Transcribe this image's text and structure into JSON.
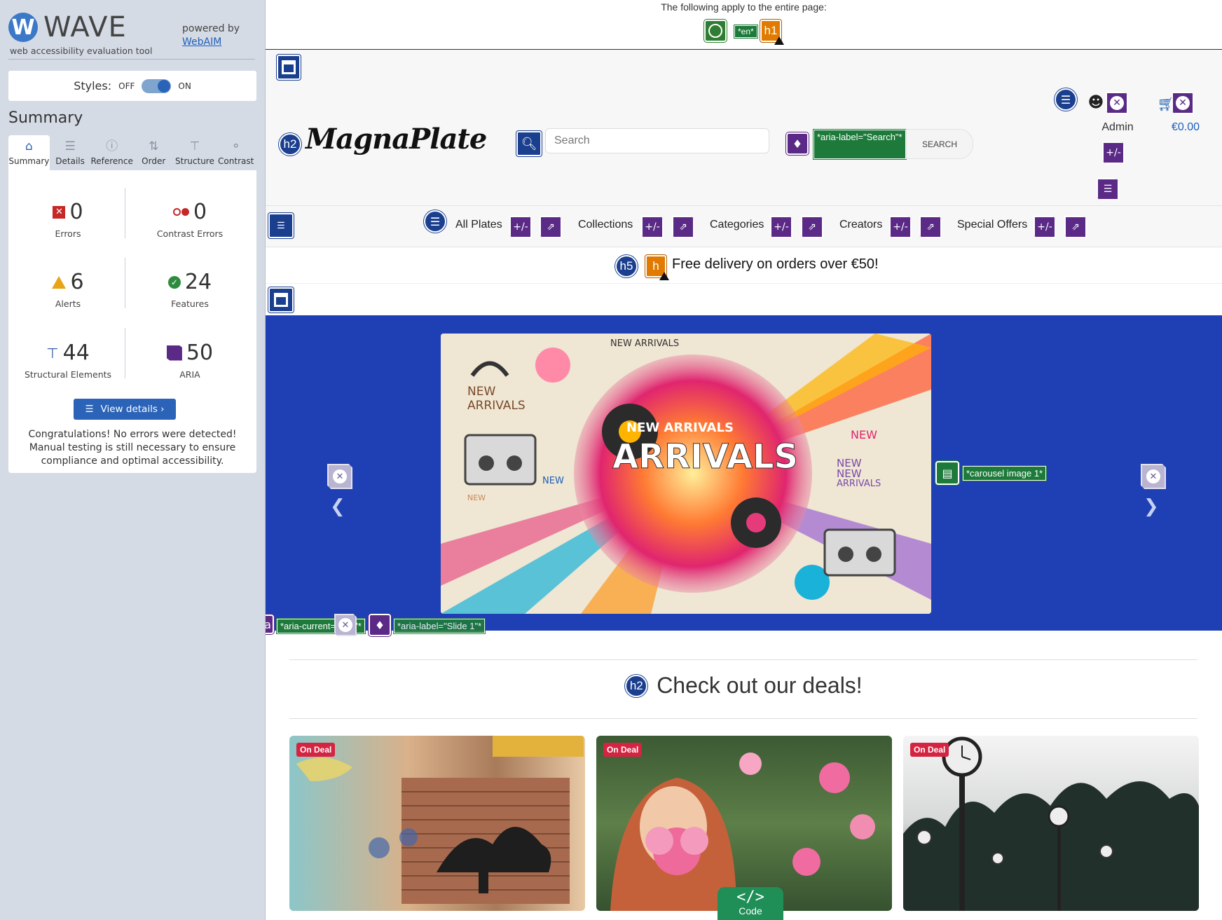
{
  "wave": {
    "logo_letter": "W",
    "logo_word": "WAVE",
    "subtitle": "web accessibility evaluation tool",
    "powered_by": "powered by",
    "webaim_link": "WebAIM",
    "styles_label": "Styles:",
    "styles_off": "OFF",
    "styles_on": "ON",
    "summary_heading": "Summary",
    "tabs": [
      {
        "label": "Summary",
        "icon": "home-icon"
      },
      {
        "label": "Details",
        "icon": "list-icon"
      },
      {
        "label": "Reference",
        "icon": "info-icon"
      },
      {
        "label": "Order",
        "icon": "order-icon"
      },
      {
        "label": "Structure",
        "icon": "structure-icon"
      },
      {
        "label": "Contrast",
        "icon": "contrast-icon"
      }
    ],
    "stats": {
      "errors": {
        "value": "0",
        "label": "Errors"
      },
      "contrast": {
        "value": "0",
        "label": "Contrast Errors"
      },
      "alerts": {
        "value": "6",
        "label": "Alerts"
      },
      "features": {
        "value": "24",
        "label": "Features"
      },
      "structural": {
        "value": "44",
        "label": "Structural Elements"
      },
      "aria": {
        "value": "50",
        "label": "ARIA"
      }
    },
    "view_details": "View details ›",
    "congrats": "Congratulations! No errors were detected! Manual testing is still necessary to ensure compliance and optimal accessibility."
  },
  "page_bar": {
    "text": "The following apply to the entire page:",
    "lang_tag": "*en*",
    "h1_tag": "h1"
  },
  "site": {
    "logo": "MagnaPlate",
    "h2_tag": "h2",
    "search_placeholder": "Search",
    "search_aria": "*aria-label=\"Search\"*",
    "search_button": "SEARCH",
    "admin": "Admin",
    "cart": "€0.00",
    "plus_minus": "+/-",
    "nav": [
      "All Plates",
      "Collections",
      "Categories",
      "Creators",
      "Special Offers"
    ],
    "promo_tag": "h5",
    "promo_h": "h",
    "promo": "Free delivery on orders over €50!",
    "carousel_alt": "*carousel image 1*",
    "aria_current": "*aria-current=\"true\"*",
    "aria_slide": "*aria-label=\"Slide 1\"*",
    "deals_heading": "Check out our deals!",
    "deal_badge": "On Deal",
    "code_label": "Code",
    "code_glyph": "</>",
    "hero_texts": {
      "new_arrivals_top": "NEW ARRIVALS",
      "new_arrivals_left_1": "NEW",
      "new_arrivals_left_2": "ARRIVALS",
      "banner_small": "NEW ARRIVALS",
      "banner_big": "ARRIVALS",
      "new_right": "NEW",
      "new_right_2": "NEW",
      "new_right_3": "NEW",
      "arrivals_right": "ARRIVALS",
      "new_small": "NEW",
      "new_small_2": "NEW"
    }
  },
  "colors": {
    "wave_blue": "#2a63b8",
    "structure": "#1b3f8f",
    "aria": "#5b2a86",
    "feature": "#1d7a3a",
    "alert": "#e07b00",
    "hero": "#1e40b4",
    "deal": "#d42442"
  }
}
